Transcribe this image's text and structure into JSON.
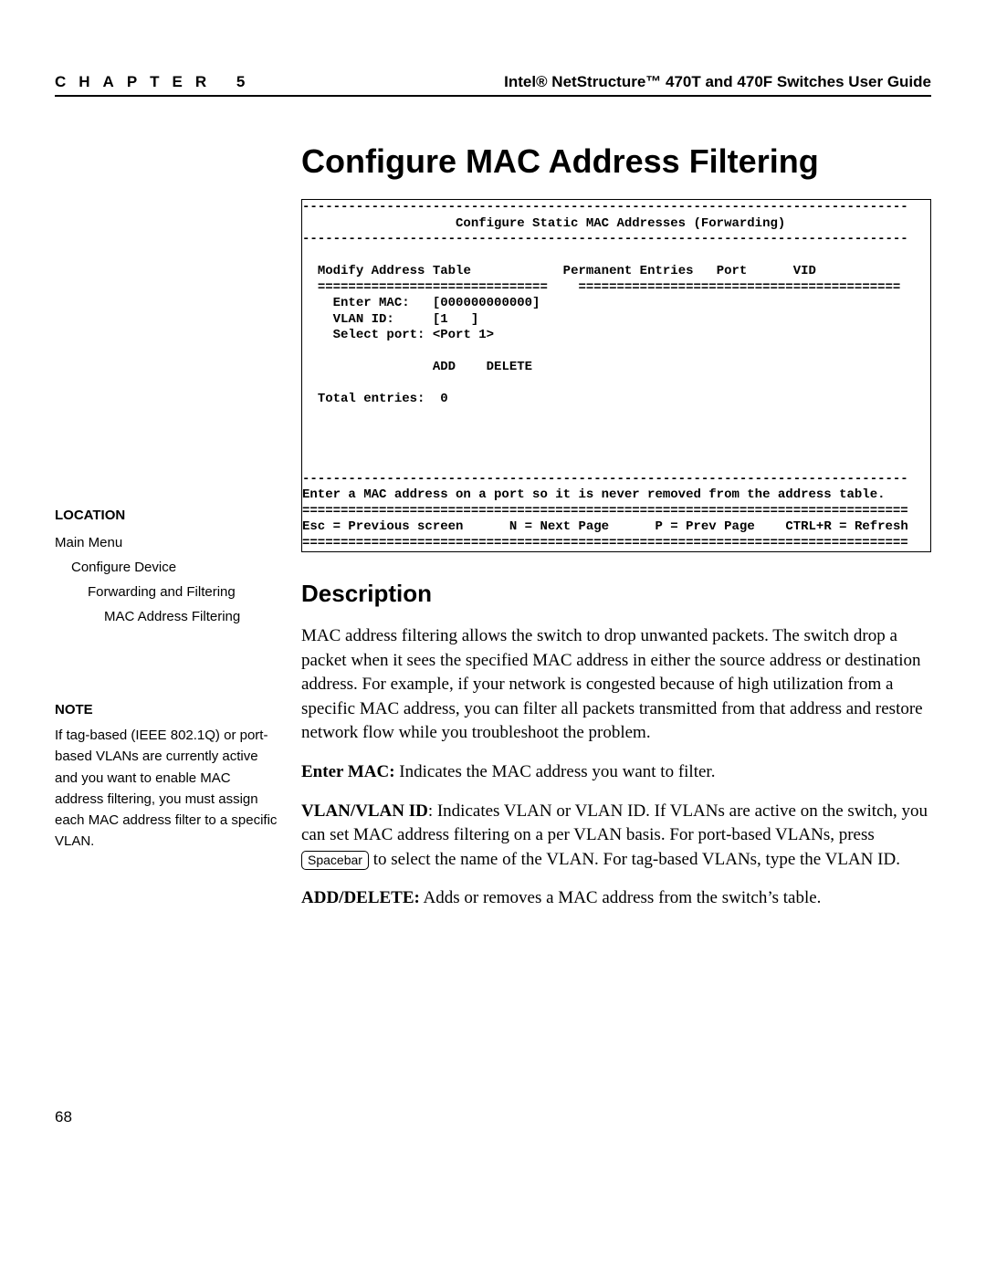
{
  "header": {
    "chapter_label": "CHAPTER 5",
    "guide_title": "Intel® NetStructure™ 470T and 470F Switches User Guide"
  },
  "page_title": "Configure MAC Address Filtering",
  "terminal": {
    "rule_long": "-------------------------------------------------------------------------------",
    "rule_dbl": "===============================================================================",
    "title": "Configure Static MAC Addresses (Forwarding)",
    "modify_addr_table": "Modify Address Table",
    "perm_entries": "Permanent Entries",
    "port_col": "Port",
    "vid_col": "VID",
    "rule_left": "==============================",
    "rule_right": "==========================================",
    "enter_mac_label": "Enter MAC:",
    "enter_mac_value": "[000000000000]",
    "vlan_id_label": "VLAN ID:",
    "vlan_id_value": "[1   ]",
    "select_port_label": "Select port:",
    "select_port_value": "<Port 1>",
    "add": "ADD",
    "delete": "DELETE",
    "total_entries_label": "Total entries:",
    "total_entries_value": "0",
    "hint": "Enter a MAC address on a port so it is never removed from the address table.",
    "esc": "Esc = Previous screen",
    "next": "N = Next Page",
    "prev": "P = Prev Page",
    "refresh": "CTRL+R = Refresh"
  },
  "sidebar": {
    "location_heading": "LOCATION",
    "loc1": "Main Menu",
    "loc2": "Configure Device",
    "loc3": "Forwarding and Filtering",
    "loc4": "MAC Address Filtering",
    "note_heading": "NOTE",
    "note_text": "If tag-based (IEEE 802.1Q) or port-based VLANs are currently active and you want to enable MAC address filtering, you must assign each MAC address filter to a specific VLAN."
  },
  "description": {
    "heading": "Description",
    "p1": "MAC address filtering allows the switch to drop unwanted packets. The switch drop a packet when it sees the specified MAC address in either the source address or destination address. For example, if your network is congested because of high utilization from a specific MAC address, you can filter all packets transmitted from that address and restore network flow while you troubleshoot the problem.",
    "enter_mac_label": "Enter MAC:",
    "enter_mac_text": " Indicates the MAC address you want to filter.",
    "vlan_label": "VLAN/VLAN ID",
    "vlan_text_a": ": Indicates VLAN or VLAN ID. If VLANs are active on the switch, you can set MAC address filtering on a per VLAN basis. For port-based VLANs, press ",
    "vlan_key": "Spacebar",
    "vlan_text_b": " to select the name of the VLAN. For tag-based VLANs, type the VLAN ID.",
    "adddel_label": "ADD/DELETE:",
    "adddel_text": " Adds or removes a MAC address from the switch’s table."
  },
  "page_number": "68"
}
